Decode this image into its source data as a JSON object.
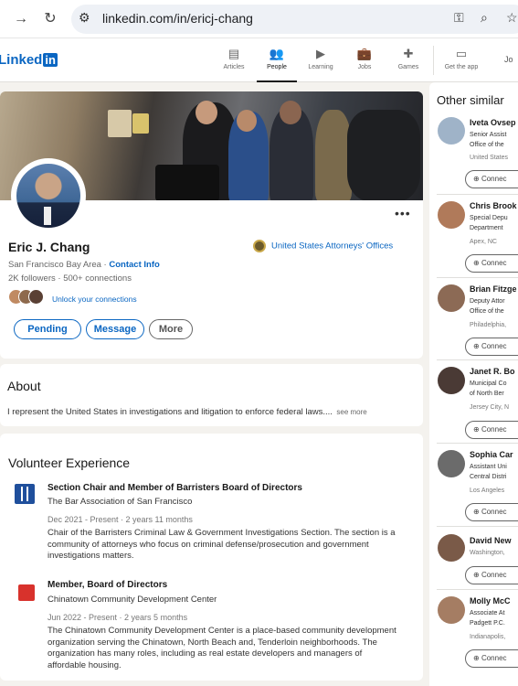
{
  "browser": {
    "url": "linkedin.com/in/ericj-chang",
    "back_icon": "arrow-right-icon",
    "reload_icon": "reload-icon"
  },
  "nav": {
    "logo_text": "Linked",
    "logo_in": "in",
    "items": [
      {
        "label": "Articles",
        "icon": "▤"
      },
      {
        "label": "People",
        "icon": "👥"
      },
      {
        "label": "Learning",
        "icon": "▶"
      },
      {
        "label": "Jobs",
        "icon": "💼"
      },
      {
        "label": "Games",
        "icon": "✚"
      },
      {
        "label": "Get the app",
        "icon": "▭"
      }
    ],
    "join_partial": "Jo"
  },
  "profile": {
    "name": "Eric J. Chang",
    "location": "San Francisco Bay Area",
    "contact_info": "Contact Info",
    "followers": "2K followers",
    "connections": "500+ connections",
    "unlock": "Unlock your connections",
    "organization": "United States Attorneys' Offices",
    "buttons": {
      "pending": "Pending",
      "message": "Message",
      "more": "More"
    },
    "more_dots": "•••"
  },
  "about": {
    "title": "About",
    "text": "I represent the United States in investigations and litigation to enforce federal laws....",
    "see_more": "see more"
  },
  "volunteer": {
    "title": "Volunteer Experience",
    "items": [
      {
        "title": "Section Chair and Member of Barristers Board of Directors",
        "org": "The Bar Association of San Francisco",
        "date": "Dec 2021 - Present · 2 years 11 months",
        "desc": "Chair of the Barristers Criminal Law & Government Investigations Section. The section is a community of attorneys who focus on criminal defense/prosecution and government investigations matters."
      },
      {
        "title": "Member, Board of Directors",
        "org": "Chinatown Community Development Center",
        "date": "Jun 2022 - Present · 2 years 5 months",
        "desc": "The Chinatown Community Development Center is a place-based community development organization serving the Chinatown, North Beach and, Tenderloin neighborhoods. The organization has many roles, including as real estate developers and managers of affordable housing."
      }
    ]
  },
  "sidebar": {
    "title": "Other similar",
    "connect_label": "Connec",
    "people": [
      {
        "name": "Iveta Ovsep",
        "l1": "Senior Assist",
        "l2": "Office of the",
        "loc": "United States",
        "color": "#9fb3c8"
      },
      {
        "name": "Chris Brook",
        "l1": "Special Depu",
        "l2": "Department",
        "loc": "Apex, NC",
        "color": "#b07a5a"
      },
      {
        "name": "Brian Fitzge",
        "l1": "Deputy Attor",
        "l2": "Office of the",
        "loc": "Philadelphia,",
        "color": "#8c6a55"
      },
      {
        "name": "Janet R. Bo",
        "l1": "Municipal Co",
        "l2": "of North Ber",
        "loc": "Jersey City, N",
        "color": "#4a3a35"
      },
      {
        "name": "Sophia Car",
        "l1": "Assistant Uni",
        "l2": "Central Distri",
        "loc": "Los Angeles",
        "color": "#6b6b6b"
      },
      {
        "name": "David New",
        "l1": "Washington,",
        "l2": "",
        "loc": "",
        "color": "#7a5a48"
      },
      {
        "name": "Molly McC",
        "l1": "Associate At",
        "l2": "Padgett P.C.",
        "loc": "Indianapolis,",
        "color": "#a57d63"
      }
    ]
  }
}
